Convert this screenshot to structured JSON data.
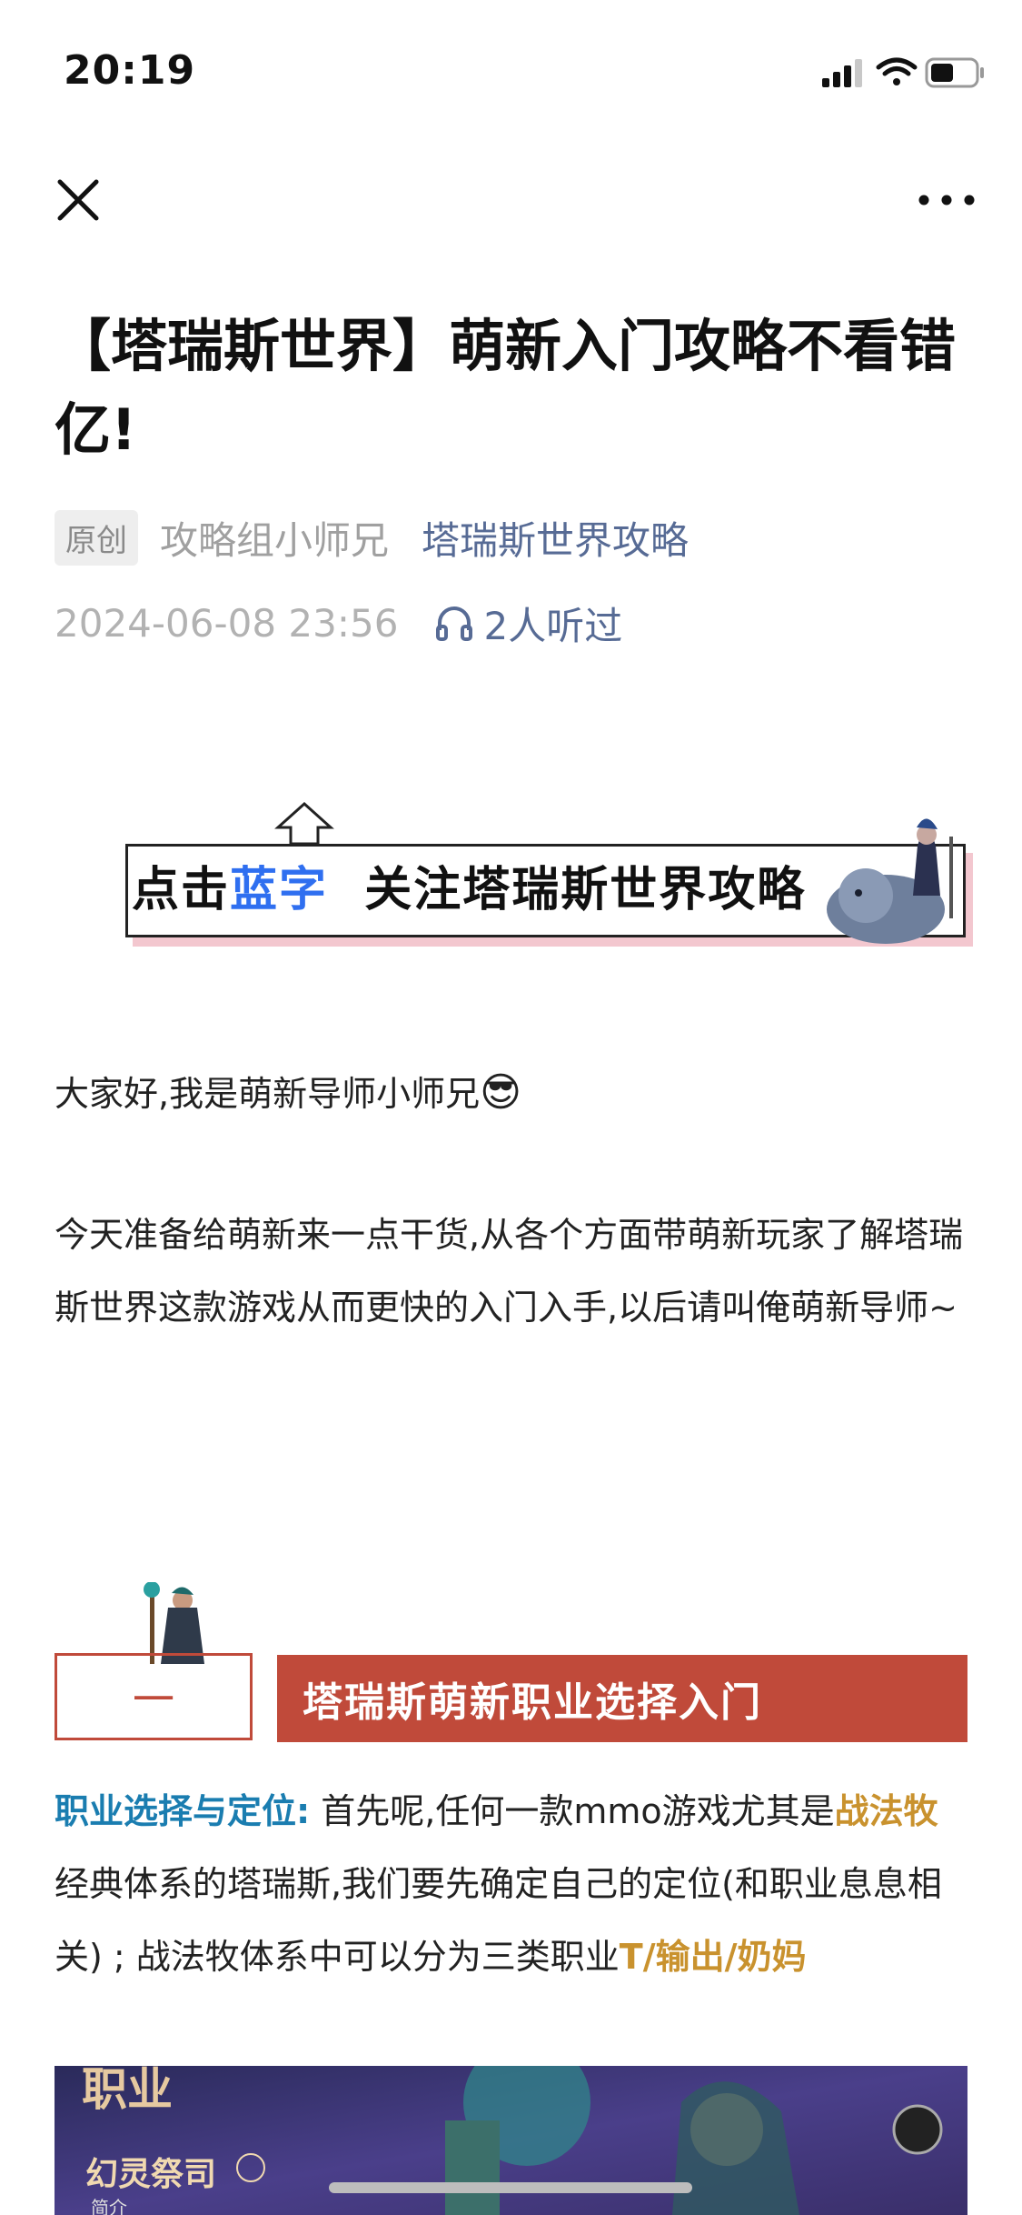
{
  "status_bar": {
    "time": "20:19"
  },
  "nav": {
    "close_icon": "close-icon",
    "more_icon": "more-dots-icon"
  },
  "article": {
    "title": "【塔瑞斯世界】萌新入门攻略不看错亿!",
    "tag": "原创",
    "author": "攻略组小师兄",
    "account": "塔瑞斯世界攻略",
    "date": "2024-06-08 23:56",
    "listen_count": "2人听过"
  },
  "banner": {
    "text_a": "点击",
    "text_blue": "蓝字",
    "text_b": "关注塔瑞斯世界攻略"
  },
  "body": {
    "greeting": "大家好,我是萌新导师小师兄",
    "emoji": "😎",
    "intro": "今天准备给萌新来一点干货,从各个方面带萌新玩家了解塔瑞斯世界这款游戏从而更快的入门入手,以后请叫俺萌新导师~",
    "section1": {
      "number": "一",
      "title": "塔瑞斯萌新职业选择入门"
    },
    "para": {
      "lead": "职业选择与定位:",
      "text1": " 首先呢,任何一款mmo游戏尤其是",
      "hl1": "战法牧",
      "text2": "经典体系的塔瑞斯,我们要先确定自己的定位(和职业息息相关) ; 战法牧体系中可以分为三类职业",
      "hl2": "T/输出/奶妈"
    }
  },
  "bottom_image": {
    "label1": "职业",
    "label2": "幻灵祭司",
    "label3": "简介"
  },
  "colors": {
    "accent_red": "#c04a3a",
    "link_blue": "#576b95",
    "highlight_blue": "#1a7db0",
    "highlight_gold": "#c9922e"
  }
}
